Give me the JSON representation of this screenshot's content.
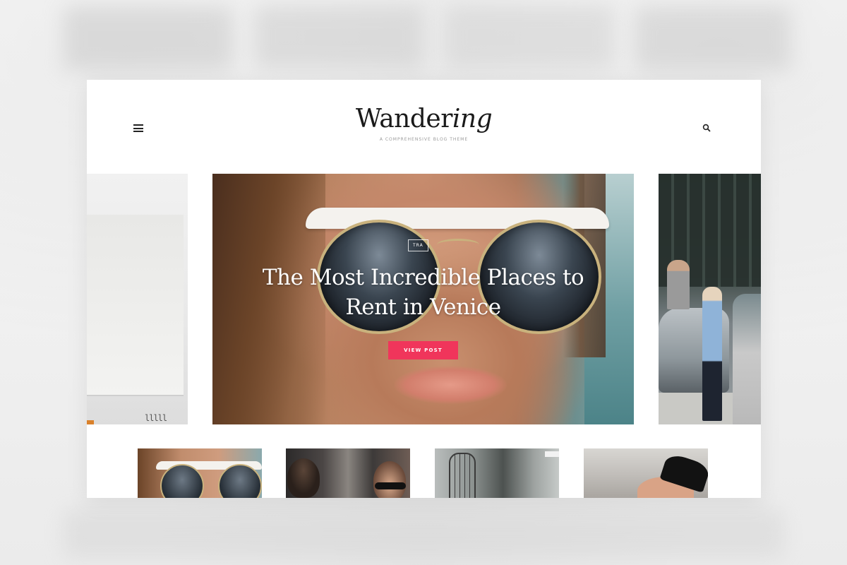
{
  "site": {
    "logo_main": "Wander",
    "logo_italic": "ing",
    "tagline": "A COMPREHENSIVE BLOG THEME"
  },
  "header": {
    "menu_icon": "hamburger-menu-icon",
    "search_icon": "search-icon"
  },
  "hero": {
    "category": "TRA",
    "title": "The Most Incredible Places to Rent in Venice",
    "button_label": "VIEW POST"
  },
  "colors": {
    "accent": "#f0355b",
    "text": "#1a1a1a",
    "background": "#ffffff"
  }
}
